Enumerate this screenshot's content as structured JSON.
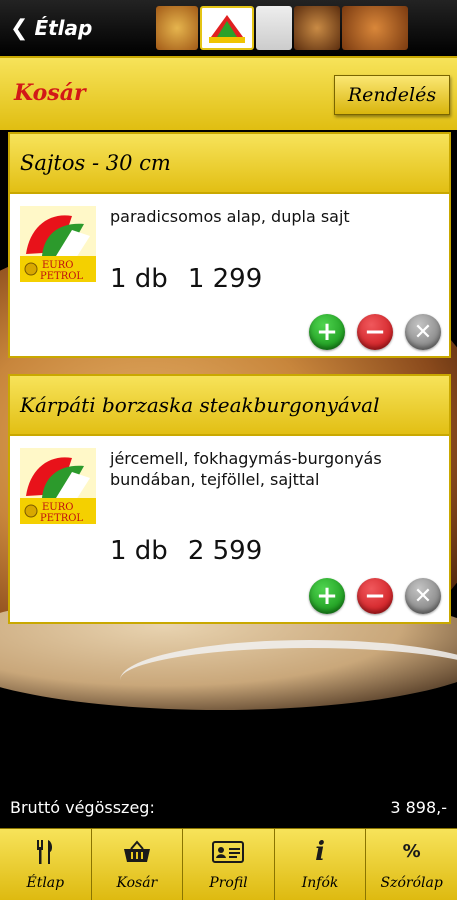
{
  "topbar": {
    "back_label": "Étlap"
  },
  "header": {
    "title": "Kosár",
    "order_button": "Rendelés"
  },
  "cart_items": [
    {
      "name": "Sajtos - 30 cm",
      "description": "paradicsomos alap, dupla sajt",
      "quantity": "1 db",
      "price": "1 299"
    },
    {
      "name": "Kárpáti borzaska steakburgonyával",
      "description": "jércemell, fokhagymás-burgonyás bundában, tejföllel, sajttal",
      "quantity": "1 db",
      "price": "2 599"
    }
  ],
  "logo": {
    "line1": "EURO",
    "line2": "PETROL"
  },
  "total": {
    "label": "Bruttó végösszeg:",
    "value": "3 898,-"
  },
  "nav": [
    {
      "label": "Étlap",
      "icon": "fork-knife-icon"
    },
    {
      "label": "Kosár",
      "icon": "basket-icon"
    },
    {
      "label": "Profil",
      "icon": "id-card-icon"
    },
    {
      "label": "Infók",
      "icon": "info-icon"
    },
    {
      "label": "Szórólap",
      "icon": "percent-icon"
    }
  ],
  "colors": {
    "accent_yellow": "#f2d22e",
    "title_red": "#d21818",
    "plus_green": "#0d8a10",
    "minus_red": "#c50d12"
  }
}
